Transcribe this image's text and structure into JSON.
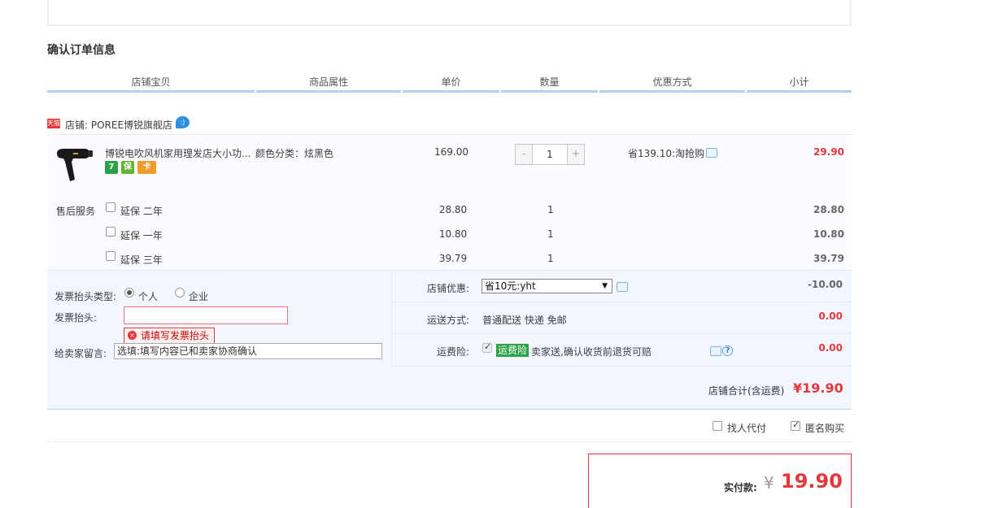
{
  "section_title": "确认订单信息",
  "columns": [
    "店铺宝贝",
    "商品属性",
    "单价",
    "数量",
    "优惠方式",
    "小计"
  ],
  "shop": {
    "tag": "天猫",
    "label": "店铺: POREE博锐旗舰店"
  },
  "item": {
    "title": "博锐电吹风机家用理发店大小功...",
    "attribute": "颜色分类：炫黑色",
    "unit_price": "169.00",
    "quantity": "1",
    "discount": "省139.10:淘抢购",
    "subtotal": "29.90",
    "badges": [
      "7",
      "保",
      "卡"
    ]
  },
  "after_sales": {
    "label": "售后服务",
    "options": [
      {
        "name": "延保  二年",
        "price": "28.80",
        "qty": "1",
        "subtotal": "28.80"
      },
      {
        "name": "延保  一年",
        "price": "10.80",
        "qty": "1",
        "subtotal": "10.80"
      },
      {
        "name": "延保  三年",
        "price": "39.79",
        "qty": "1",
        "subtotal": "39.79"
      }
    ]
  },
  "invoice": {
    "type_label": "发票抬头类型:",
    "personal": "个人",
    "company": "企业",
    "title_label": "发票抬头:",
    "title_value": "",
    "error": "请填写发票抬头",
    "message_label": "给卖家留言:",
    "message_value": "选填:填写内容已和卖家协商确认"
  },
  "shop_discount": {
    "label": "店铺优惠:",
    "selected": "省10元:yht",
    "amount": "-10.00"
  },
  "shipping": {
    "label": "运送方式:",
    "value": "普通配送 快递 免邮",
    "amount": "0.00"
  },
  "insurance": {
    "label": "运费险:",
    "tag": "运费险",
    "text": "卖家送,确认收货前退货可赔",
    "amount": "0.00"
  },
  "shop_total": {
    "label": "店铺合计(含运费)",
    "value": "¥19.90"
  },
  "options": {
    "proxy_pay": "找人代付",
    "anonymous": "匿名购买"
  },
  "payment": {
    "label": "实付款:",
    "currency": "¥",
    "value": "19.90"
  },
  "colors": {
    "accent": "#e4393c",
    "header_line": "#b2d1f0",
    "panel": "#f2f7ff",
    "insurance_green": "#2ba247"
  }
}
